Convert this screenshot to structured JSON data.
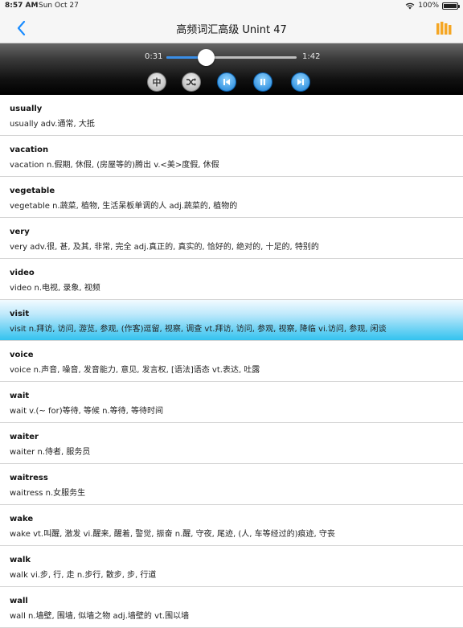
{
  "status_bar": {
    "time": "8:57 AM",
    "date": "Sun Oct 27",
    "battery": "100%"
  },
  "nav": {
    "title": "高频词汇高级 Unint 47"
  },
  "player": {
    "current_time": "0:31",
    "total_time": "1:42",
    "progress": 0.3,
    "buttons": {
      "language_label": "中"
    }
  },
  "words": [
    {
      "word": "usually",
      "definition": "usually  adv.通常, 大抵"
    },
    {
      "word": "vacation",
      "definition": "vacation n.假期, 休假, (房屋等的)腾出 v.<美>度假, 休假"
    },
    {
      "word": "vegetable",
      "definition": "vegetable n.蔬菜, 植物, 生活呆板单调的人  adj.蔬菜的, 植物的"
    },
    {
      "word": "very",
      "definition": "very  adv.很, 甚, 及其, 非常, 完全  adj.真正的, 真实的, 恰好的, 绝对的, 十足的, 特别的"
    },
    {
      "word": "video",
      "definition": "video n.电视, 录象, 视频"
    },
    {
      "word": "visit",
      "definition": "visit n.拜访, 访问, 游览, 参观, (作客)逗留, 视察, 调查 vt.拜访, 访问, 参观, 视察, 降临 vi.访问, 参观, 闲谈",
      "selected": true
    },
    {
      "word": "voice",
      "definition": "voice n.声音, 噪音, 发音能力, 意见, 发言权, [语法]语态 vt.表达, 吐露"
    },
    {
      "word": "wait",
      "definition": "wait v.(~ for)等待, 等候 n.等待, 等待时间"
    },
    {
      "word": "waiter",
      "definition": "waiter n.侍者, 服务员"
    },
    {
      "word": "waitress",
      "definition": "waitress n.女服务生"
    },
    {
      "word": "wake",
      "definition": "wake vt.叫醒, 激发 vi.醒来, 醒着, 警觉, 振奋 n.醒, 守夜, 尾迹, (人, 车等经过的)痕迹, 守丧"
    },
    {
      "word": "walk",
      "definition": "walk vi.步, 行, 走 n.步行, 散步, 步, 行道"
    },
    {
      "word": "wall",
      "definition": "wall n.墙壁, 围墙, 似墙之物  adj.墙壁的 vt.围以墙"
    }
  ],
  "colors": {
    "accent_blue": "#1a8cff",
    "accent_orange": "#f5a623",
    "selected_row": "#33c2ef"
  },
  "icons": {
    "back": "chevron-left-icon",
    "menu": "bars-icon",
    "shuffle": "shuffle-icon",
    "previous": "skip-previous-icon",
    "pause": "pause-icon",
    "next": "skip-next-icon"
  }
}
